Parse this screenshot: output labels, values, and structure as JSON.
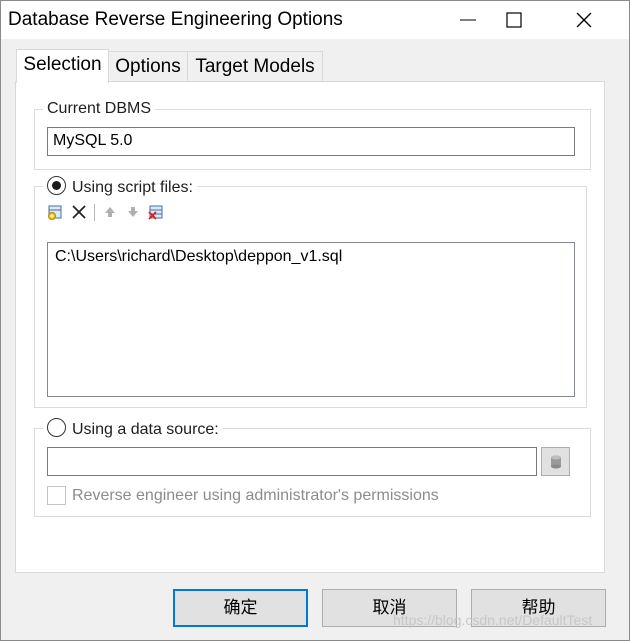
{
  "window": {
    "title": "Database Reverse Engineering Options"
  },
  "tabs": [
    {
      "label": "Selection",
      "active": true
    },
    {
      "label": "Options",
      "active": false
    },
    {
      "label": "Target Models",
      "active": false
    }
  ],
  "dbms": {
    "group_label": "Current DBMS",
    "value": "MySQL 5.0"
  },
  "script_files": {
    "radio_label": "Using script files:",
    "selected": true,
    "toolbar": [
      "add-file-icon",
      "delete-icon",
      "move-up-icon",
      "move-down-icon",
      "clear-list-icon"
    ],
    "files": [
      "C:\\Users\\richard\\Desktop\\deppon_v1.sql"
    ]
  },
  "data_source": {
    "radio_label": "Using a data source:",
    "selected": false,
    "value": "",
    "browse_icon": "data-source-icon",
    "admin_checkbox_label": "Reverse engineer using administrator's permissions",
    "admin_checked": false
  },
  "buttons": {
    "ok": "确定",
    "cancel": "取消",
    "help": "帮助"
  },
  "watermark": "https://blog.csdn.net/DefaultTest",
  "colors": {
    "accent": "#0078d7",
    "dialog_bg": "#f0f0f0",
    "panel_bg": "#ffffff"
  }
}
